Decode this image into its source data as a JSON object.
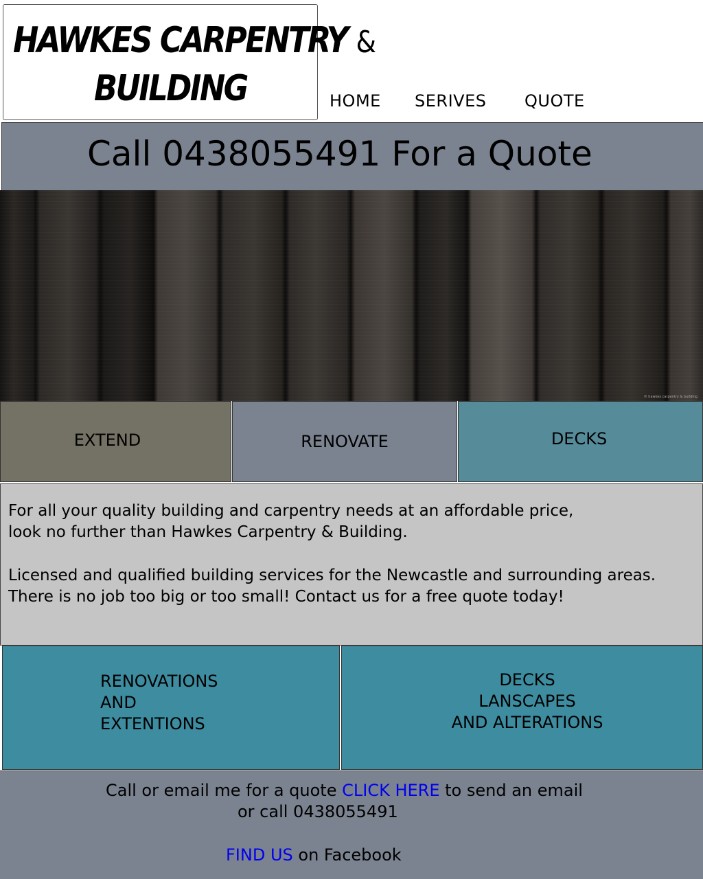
{
  "logo": {
    "line1": "HAWKES CARPENTRY",
    "amp": "&",
    "line2": "BUILDING"
  },
  "nav": {
    "home": "HOME",
    "services": "SERIVES",
    "quote": "QUOTE"
  },
  "banner": {
    "text": "Call 0438055491 For a Quote"
  },
  "hero": {
    "credit": "© hawkes carpentry & building"
  },
  "tiles": {
    "extend": "EXTEND",
    "renovate": "RENOVATE",
    "decks": "DECKS"
  },
  "intro": {
    "paragraph1": "For all your quality building and carpentry needs at an affordable price,\nlook no further than Hawkes Carpentry & Building.",
    "paragraph2": "Licensed and qualified building services for the Newcastle and surrounding areas.\nThere is no job too big or too small! Contact us for a free quote today!"
  },
  "services": {
    "left": "RENOVATIONS\n  AND\nEXTENTIONS",
    "right": "DECKS\n LANSCAPES\nAND ALTERATIONS"
  },
  "footer": {
    "call_prefix": "Call or email me for a quote ",
    "click_here": "CLICK HERE",
    "call_suffix": " to send an email",
    "call_line2": "or call 0438055491",
    "find_us": "FIND US",
    "facebook_suffix": " on Facebook"
  },
  "colors": {
    "banner": "#7b8390",
    "tile_extend": "#737265",
    "tile_renovate": "#7b8390",
    "tile_decks": "#568c9a",
    "intro_bg": "#c5c5c5",
    "services_bg": "#3e8ca0",
    "link": "#0000ee"
  }
}
